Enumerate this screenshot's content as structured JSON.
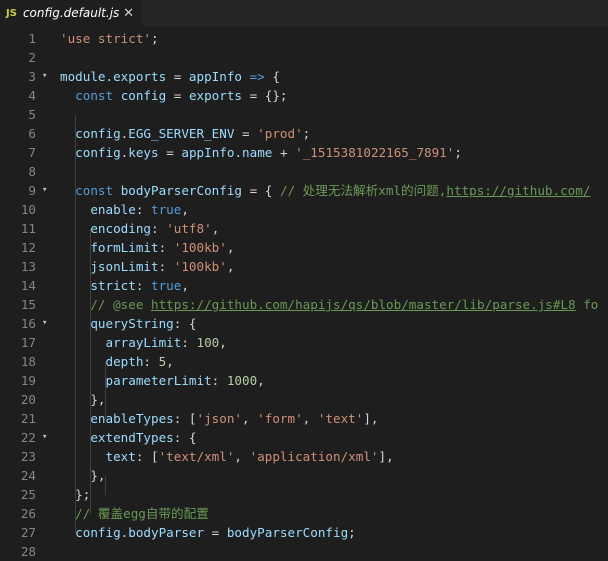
{
  "tab": {
    "lang_badge": "JS",
    "filename": "config.default.js",
    "close_glyph": "✕"
  },
  "lines": [
    {
      "n": "1",
      "fold": "",
      "t": [
        [
          "s",
          "'use strict'"
        ],
        [
          "p",
          ";"
        ]
      ]
    },
    {
      "n": "2",
      "fold": "",
      "t": []
    },
    {
      "n": "3",
      "fold": "▾",
      "t": [
        [
          "v",
          "module"
        ],
        [
          "p",
          "."
        ],
        [
          "v",
          "exports"
        ],
        [
          "p",
          " = "
        ],
        [
          "v",
          "appInfo"
        ],
        [
          "p",
          " "
        ],
        [
          "k",
          "=>"
        ],
        [
          "p",
          " {"
        ]
      ]
    },
    {
      "n": "4",
      "fold": "",
      "t": [
        [
          "p",
          "  "
        ],
        [
          "k",
          "const"
        ],
        [
          "p",
          " "
        ],
        [
          "v",
          "config"
        ],
        [
          "p",
          " = "
        ],
        [
          "v",
          "exports"
        ],
        [
          "p",
          " = {};"
        ]
      ]
    },
    {
      "n": "5",
      "fold": "",
      "t": []
    },
    {
      "n": "6",
      "fold": "",
      "t": [
        [
          "p",
          "  "
        ],
        [
          "v",
          "config"
        ],
        [
          "p",
          "."
        ],
        [
          "v",
          "EGG_SERVER_ENV"
        ],
        [
          "p",
          " = "
        ],
        [
          "s",
          "'prod'"
        ],
        [
          "p",
          ";"
        ]
      ]
    },
    {
      "n": "7",
      "fold": "",
      "t": [
        [
          "p",
          "  "
        ],
        [
          "v",
          "config"
        ],
        [
          "p",
          "."
        ],
        [
          "v",
          "keys"
        ],
        [
          "p",
          " = "
        ],
        [
          "v",
          "appInfo"
        ],
        [
          "p",
          "."
        ],
        [
          "v",
          "name"
        ],
        [
          "p",
          " + "
        ],
        [
          "s",
          "'_1515381022165_7891'"
        ],
        [
          "p",
          ";"
        ]
      ]
    },
    {
      "n": "8",
      "fold": "",
      "t": []
    },
    {
      "n": "9",
      "fold": "▾",
      "t": [
        [
          "p",
          "  "
        ],
        [
          "k",
          "const"
        ],
        [
          "p",
          " "
        ],
        [
          "v",
          "bodyParserConfig"
        ],
        [
          "p",
          " = { "
        ],
        [
          "c",
          "// 处理无法解析xml的问题,"
        ],
        [
          "u",
          "https://github.com/"
        ]
      ]
    },
    {
      "n": "10",
      "fold": "",
      "t": [
        [
          "p",
          "    "
        ],
        [
          "v",
          "enable"
        ],
        [
          "p",
          ": "
        ],
        [
          "k",
          "true"
        ],
        [
          "p",
          ","
        ]
      ]
    },
    {
      "n": "11",
      "fold": "",
      "t": [
        [
          "p",
          "    "
        ],
        [
          "v",
          "encoding"
        ],
        [
          "p",
          ": "
        ],
        [
          "s",
          "'utf8'"
        ],
        [
          "p",
          ","
        ]
      ]
    },
    {
      "n": "12",
      "fold": "",
      "t": [
        [
          "p",
          "    "
        ],
        [
          "v",
          "formLimit"
        ],
        [
          "p",
          ": "
        ],
        [
          "s",
          "'100kb'"
        ],
        [
          "p",
          ","
        ]
      ]
    },
    {
      "n": "13",
      "fold": "",
      "t": [
        [
          "p",
          "    "
        ],
        [
          "v",
          "jsonLimit"
        ],
        [
          "p",
          ": "
        ],
        [
          "s",
          "'100kb'"
        ],
        [
          "p",
          ","
        ]
      ]
    },
    {
      "n": "14",
      "fold": "",
      "t": [
        [
          "p",
          "    "
        ],
        [
          "v",
          "strict"
        ],
        [
          "p",
          ": "
        ],
        [
          "k",
          "true"
        ],
        [
          "p",
          ","
        ]
      ]
    },
    {
      "n": "15",
      "fold": "",
      "t": [
        [
          "p",
          "    "
        ],
        [
          "c",
          "// @see "
        ],
        [
          "u",
          "https://github.com/hapijs/qs/blob/master/lib/parse.js#L8"
        ],
        [
          "c",
          " fo"
        ]
      ]
    },
    {
      "n": "16",
      "fold": "▾",
      "t": [
        [
          "p",
          "    "
        ],
        [
          "v",
          "queryString"
        ],
        [
          "p",
          ": {"
        ]
      ]
    },
    {
      "n": "17",
      "fold": "",
      "t": [
        [
          "p",
          "      "
        ],
        [
          "v",
          "arrayLimit"
        ],
        [
          "p",
          ": "
        ],
        [
          "n",
          "100"
        ],
        [
          "p",
          ","
        ]
      ]
    },
    {
      "n": "18",
      "fold": "",
      "t": [
        [
          "p",
          "      "
        ],
        [
          "v",
          "depth"
        ],
        [
          "p",
          ": "
        ],
        [
          "n",
          "5"
        ],
        [
          "p",
          ","
        ]
      ]
    },
    {
      "n": "19",
      "fold": "",
      "t": [
        [
          "p",
          "      "
        ],
        [
          "v",
          "parameterLimit"
        ],
        [
          "p",
          ": "
        ],
        [
          "n",
          "1000"
        ],
        [
          "p",
          ","
        ]
      ]
    },
    {
      "n": "20",
      "fold": "",
      "t": [
        [
          "p",
          "    },"
        ]
      ]
    },
    {
      "n": "21",
      "fold": "",
      "t": [
        [
          "p",
          "    "
        ],
        [
          "v",
          "enableTypes"
        ],
        [
          "p",
          ": ["
        ],
        [
          "s",
          "'json'"
        ],
        [
          "p",
          ", "
        ],
        [
          "s",
          "'form'"
        ],
        [
          "p",
          ", "
        ],
        [
          "s",
          "'text'"
        ],
        [
          "p",
          "],"
        ]
      ]
    },
    {
      "n": "22",
      "fold": "▾",
      "t": [
        [
          "p",
          "    "
        ],
        [
          "v",
          "extendTypes"
        ],
        [
          "p",
          ": {"
        ]
      ]
    },
    {
      "n": "23",
      "fold": "",
      "t": [
        [
          "p",
          "      "
        ],
        [
          "v",
          "text"
        ],
        [
          "p",
          ": ["
        ],
        [
          "s",
          "'text/xml'"
        ],
        [
          "p",
          ", "
        ],
        [
          "s",
          "'application/xml'"
        ],
        [
          "p",
          "],"
        ]
      ]
    },
    {
      "n": "24",
      "fold": "",
      "t": [
        [
          "p",
          "    },"
        ]
      ]
    },
    {
      "n": "25",
      "fold": "",
      "t": [
        [
          "p",
          "  };"
        ]
      ]
    },
    {
      "n": "26",
      "fold": "",
      "t": [
        [
          "p",
          "  "
        ],
        [
          "c",
          "// 覆盖egg自带的配置"
        ]
      ]
    },
    {
      "n": "27",
      "fold": "",
      "t": [
        [
          "p",
          "  "
        ],
        [
          "v",
          "config"
        ],
        [
          "p",
          "."
        ],
        [
          "v",
          "bodyParser"
        ],
        [
          "p",
          " = "
        ],
        [
          "v",
          "bodyParserConfig"
        ],
        [
          "p",
          ";"
        ]
      ]
    },
    {
      "n": "28",
      "fold": "",
      "t": []
    }
  ]
}
